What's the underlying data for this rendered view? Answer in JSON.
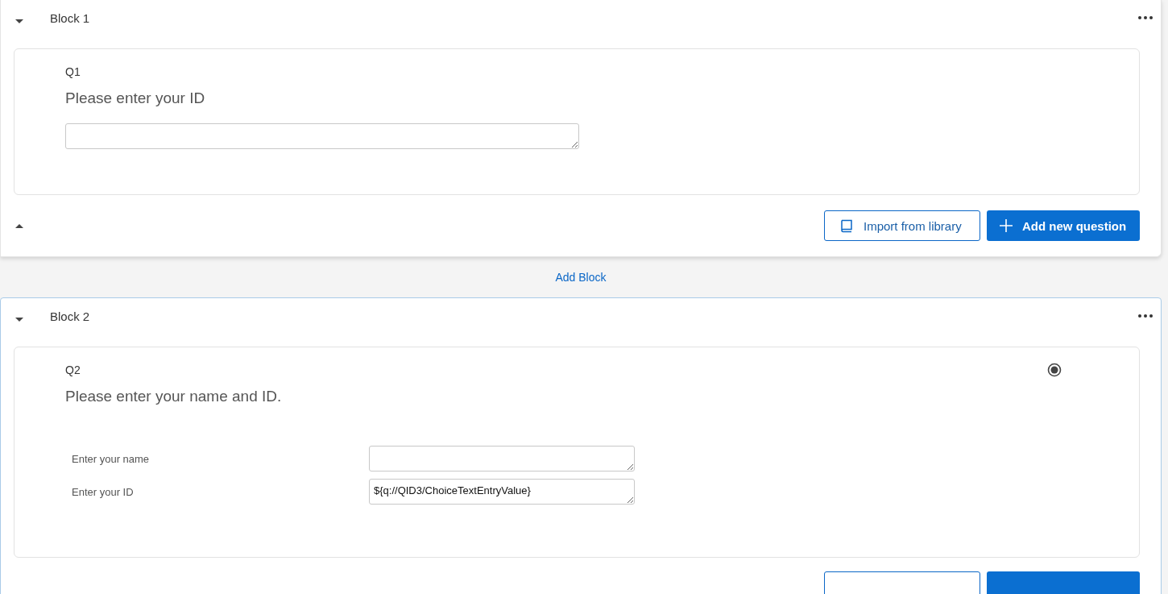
{
  "blocks": [
    {
      "title": "Block 1",
      "selected": false,
      "questions": [
        {
          "number": "Q1",
          "text": "Please enter your ID",
          "kind": "text"
        }
      ],
      "footer": {
        "import_label": "Import from library",
        "add_label": "Add new question"
      }
    },
    {
      "title": "Block 2",
      "selected": true,
      "questions": [
        {
          "number": "Q2",
          "text": "Please enter your name and ID.",
          "kind": "form",
          "radio_selected": true,
          "rows": [
            {
              "label": "Enter your name"
            },
            {
              "label": "Enter your ID",
              "value": "${q://QID3/ChoiceTextEntryValue}"
            }
          ]
        }
      ],
      "footer_cut": true
    }
  ],
  "add_block": "Add Block"
}
